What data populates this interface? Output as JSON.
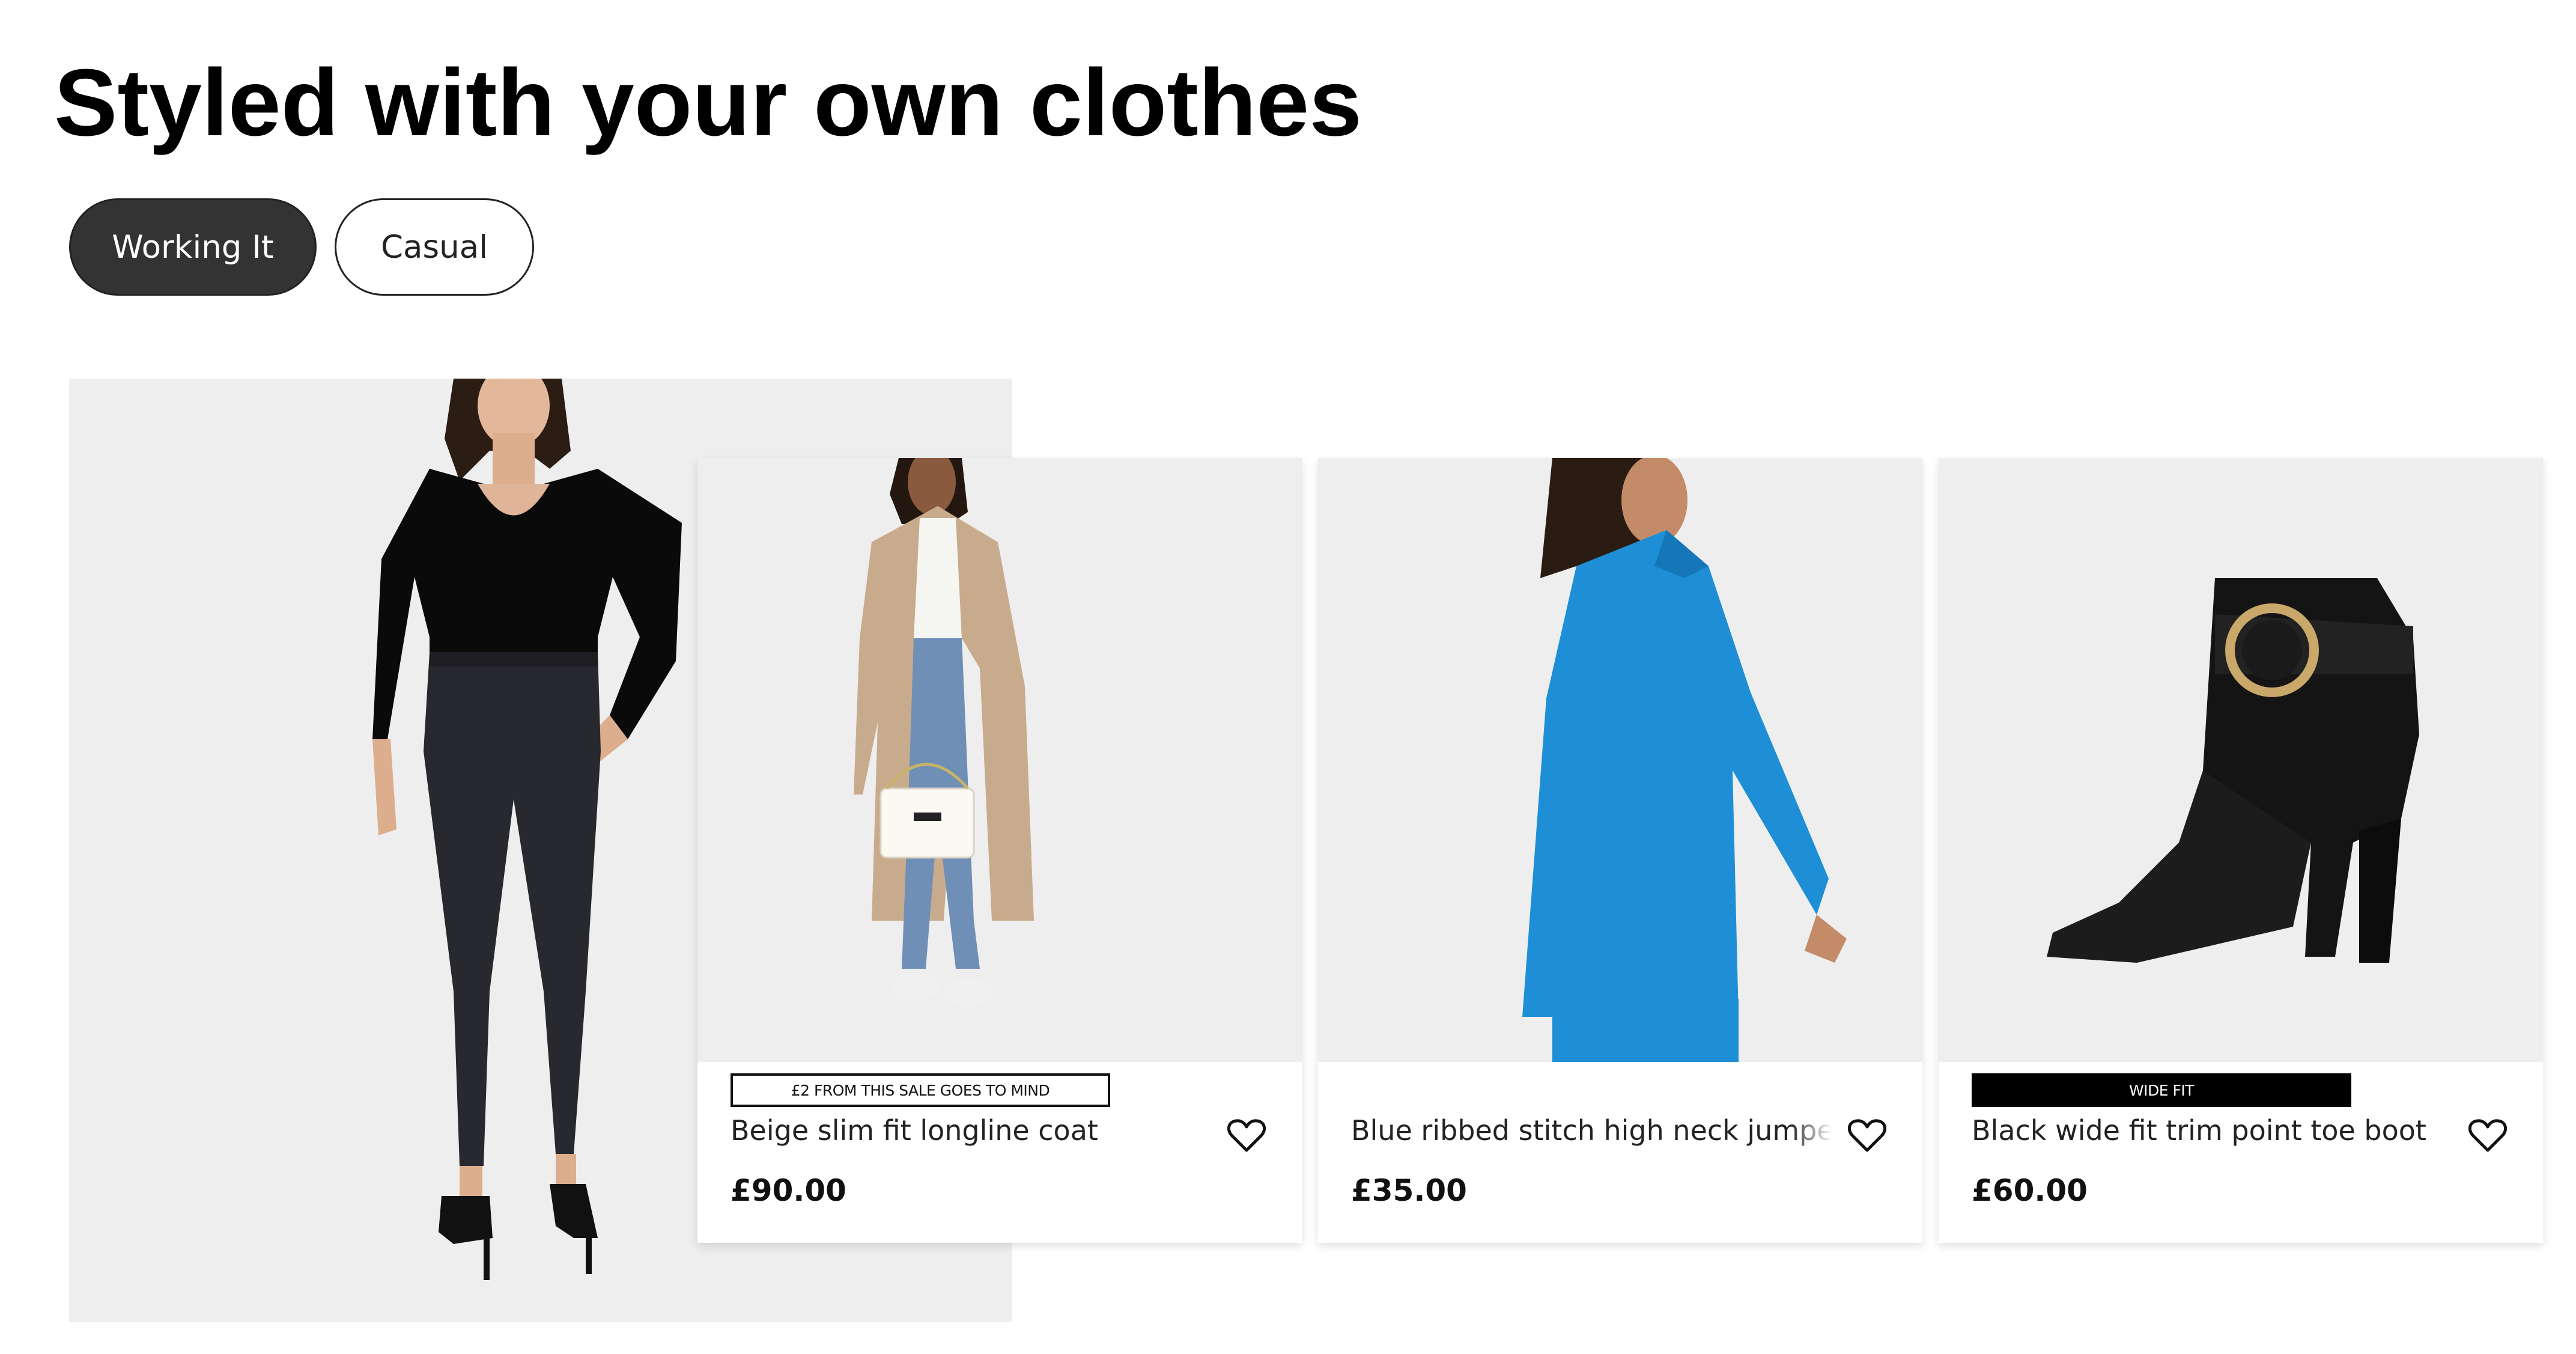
{
  "title": "Styled with your own clothes",
  "tabs": [
    {
      "label": "Working It",
      "active": true
    },
    {
      "label": "Casual",
      "active": false
    }
  ],
  "products": [
    {
      "badge": "£2 FROM THIS SALE GOES TO MIND",
      "name": "Beige slim fit longline coat",
      "price": "£90.00",
      "wishlist_icon": "heart-outline-icon"
    },
    {
      "badge": "",
      "name": "Blue ribbed stitch high neck jumper",
      "price": "£35.00",
      "wishlist_icon": "heart-outline-icon"
    },
    {
      "badge": "WIDE FIT",
      "name": "Black wide fit trim point toe boot",
      "price": "£60.00",
      "wishlist_icon": "heart-outline-icon"
    }
  ],
  "colors": {
    "active_tab_bg": "#333333",
    "image_bg": "#eeeeee",
    "badge_solid_bg": "#000000",
    "jumper_blue": "#1e8fd6"
  }
}
